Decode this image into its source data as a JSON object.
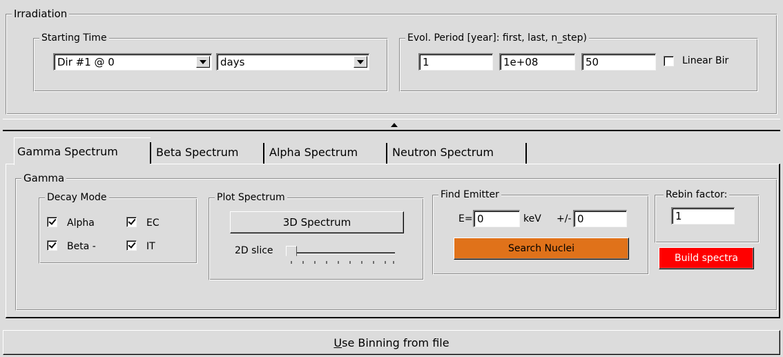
{
  "irradiation": {
    "title": "Irradiation",
    "starting_time": {
      "title": "Starting Time",
      "dir_value": "Dir #1 @ 0",
      "unit_value": "days"
    },
    "evol_period": {
      "title": "Evol. Period [year]: first, last, n_step)",
      "first": "1",
      "last": "1e+08",
      "n_step": "50",
      "linear_bin_label": "Linear Bir",
      "linear_bin_checked": false
    }
  },
  "tabs": [
    {
      "label": "Gamma Spectrum",
      "active": true
    },
    {
      "label": "Beta Spectrum",
      "active": false
    },
    {
      "label": "Alpha Spectrum",
      "active": false
    },
    {
      "label": "Neutron Spectrum",
      "active": false
    }
  ],
  "gamma": {
    "title": "Gamma",
    "decay_mode": {
      "title": "Decay Mode",
      "options": [
        {
          "label": "Alpha",
          "checked": true
        },
        {
          "label": "EC",
          "checked": true
        },
        {
          "label": "Beta -",
          "checked": true
        },
        {
          "label": "IT",
          "checked": true
        }
      ]
    },
    "plot_spectrum": {
      "title": "Plot Spectrum",
      "button_3d": "3D Spectrum",
      "slice_label": "2D slice",
      "slice_position": 0
    },
    "find_emitter": {
      "title": "Find Emitter",
      "e_label": "E=",
      "e_value": "0",
      "unit": "keV",
      "pm_label": "+/-",
      "pm_value": "0",
      "search_button": "Search Nuclei"
    },
    "rebin": {
      "title": "Rebin factor:",
      "value": "1",
      "build_button": "Build spectra"
    }
  },
  "binning_button": {
    "underlined": "U",
    "rest": "se Binning from file"
  },
  "colors": {
    "background": "#dcdcdc",
    "search_button": "#e0721a",
    "build_button": "#ff0000"
  }
}
